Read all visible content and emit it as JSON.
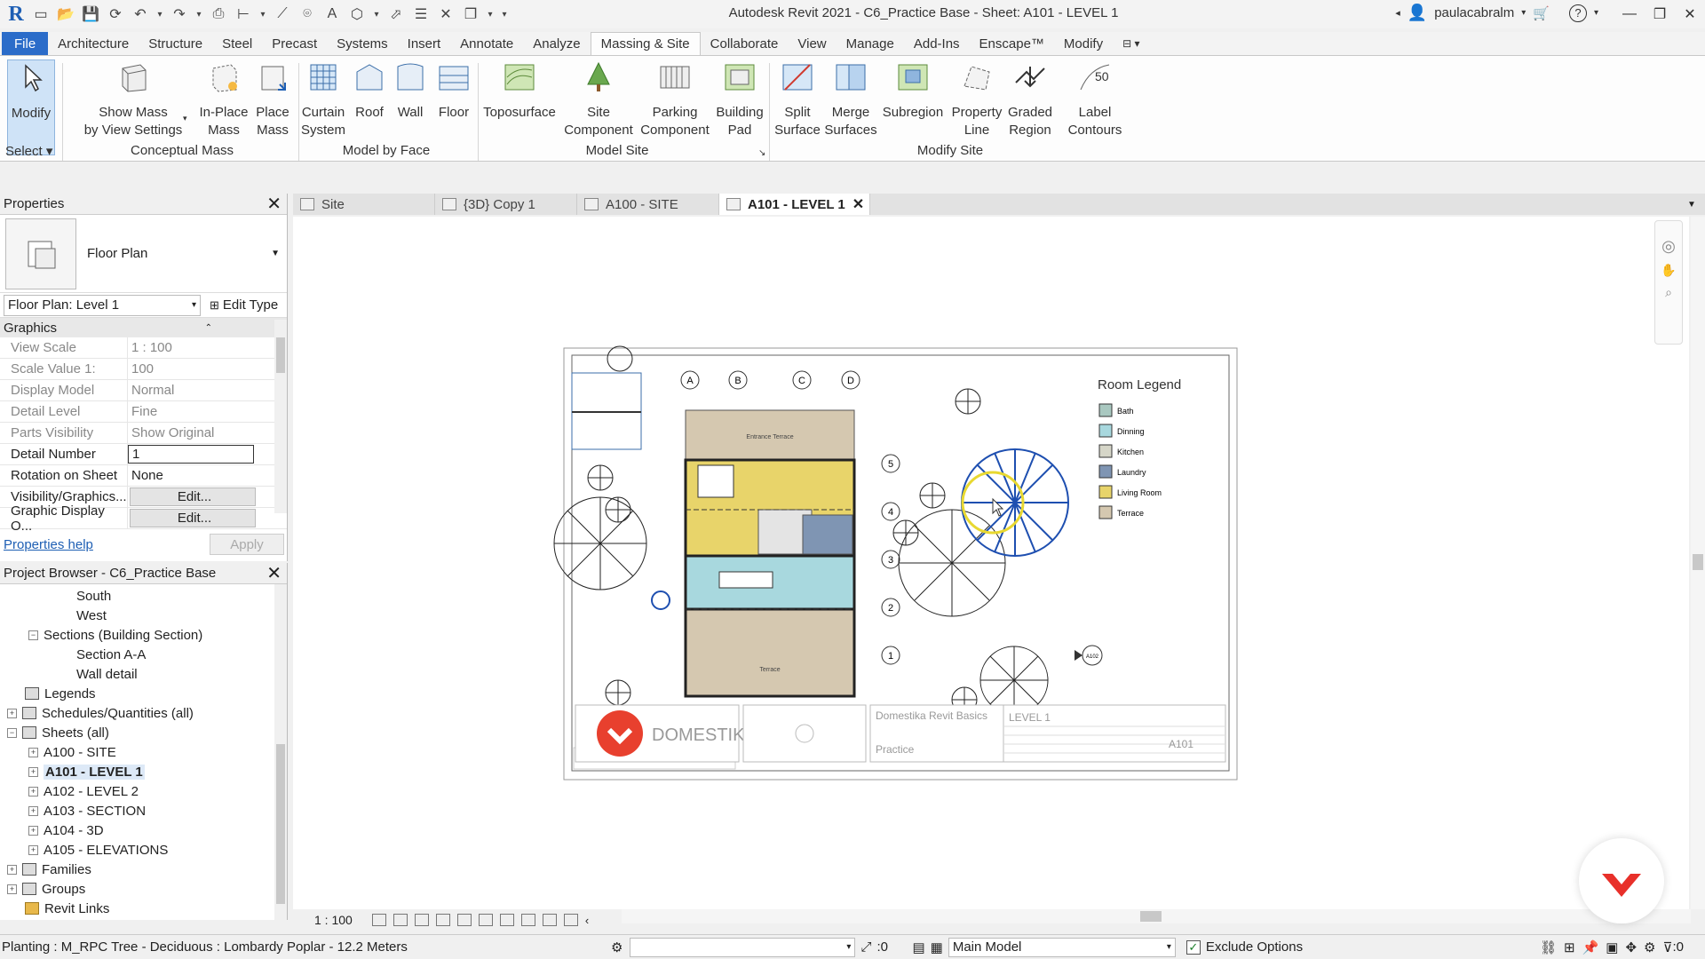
{
  "title_bar": {
    "app_title": "Autodesk Revit 2021 - C6_Practice Base - Sheet: A101 - LEVEL 1",
    "user": "paulacabralm"
  },
  "ribbon_tabs": [
    "File",
    "Architecture",
    "Structure",
    "Steel",
    "Precast",
    "Systems",
    "Insert",
    "Annotate",
    "Analyze",
    "Massing & Site",
    "Collaborate",
    "View",
    "Manage",
    "Add-Ins",
    "Enscape™",
    "Modify"
  ],
  "active_tab": "Massing & Site",
  "ribbon": {
    "modify": "Modify",
    "select": "Select",
    "panels": {
      "conceptual_mass": "Conceptual Mass",
      "model_by_face": "Model by Face",
      "model_site": "Model Site",
      "modify_site": "Modify Site"
    },
    "buttons": {
      "show_mass": [
        "Show Mass",
        "by View Settings"
      ],
      "in_place_mass": [
        "In-Place",
        "Mass"
      ],
      "place_mass": [
        "Place",
        "Mass"
      ],
      "curtain_system": [
        "Curtain",
        "System"
      ],
      "roof": [
        "Roof"
      ],
      "wall": [
        "Wall"
      ],
      "floor": [
        "Floor"
      ],
      "toposurface": [
        "Toposurface"
      ],
      "site_component": [
        "Site",
        "Component"
      ],
      "parking_component": [
        "Parking",
        "Component"
      ],
      "building_pad": [
        "Building",
        "Pad"
      ],
      "split_surface": [
        "Split",
        "Surface"
      ],
      "merge_surfaces": [
        "Merge",
        "Surfaces"
      ],
      "subregion": [
        "Subregion"
      ],
      "property_line": [
        "Property",
        "Line"
      ],
      "graded_region": [
        "Graded",
        "Region"
      ],
      "label_contours": [
        "Label",
        "Contours"
      ]
    }
  },
  "properties": {
    "title": "Properties",
    "type_name": "Floor Plan",
    "instance": "Floor Plan: Level 1",
    "edit_type": "Edit Type",
    "group": "Graphics",
    "rows": [
      {
        "key": "View Scale",
        "value": "1 : 100"
      },
      {
        "key": "Scale Value    1:",
        "value": "100"
      },
      {
        "key": "Display Model",
        "value": "Normal"
      },
      {
        "key": "Detail Level",
        "value": "Fine"
      },
      {
        "key": "Parts Visibility",
        "value": "Show Original"
      },
      {
        "key": "Detail Number",
        "value": "1"
      },
      {
        "key": "Rotation on Sheet",
        "value": "None"
      },
      {
        "key": "Visibility/Graphics...",
        "value": "Edit..."
      },
      {
        "key": "Graphic Display O...",
        "value": "Edit..."
      }
    ],
    "help": "Properties help",
    "apply": "Apply"
  },
  "project_browser": {
    "title": "Project Browser - C6_Practice Base",
    "items": [
      {
        "label": "South"
      },
      {
        "label": "West"
      },
      {
        "label": "Sections (Building Section)"
      },
      {
        "label": "Section A-A"
      },
      {
        "label": "Wall detail"
      },
      {
        "label": "Legends"
      },
      {
        "label": "Schedules/Quantities (all)"
      },
      {
        "label": "Sheets (all)"
      },
      {
        "label": "A100 - SITE"
      },
      {
        "label": "A101 - LEVEL 1"
      },
      {
        "label": "A102 - LEVEL 2"
      },
      {
        "label": "A103 - SECTION"
      },
      {
        "label": "A104 - 3D"
      },
      {
        "label": "A105 - ELEVATIONS"
      },
      {
        "label": "Families"
      },
      {
        "label": "Groups"
      },
      {
        "label": "Revit Links"
      }
    ]
  },
  "view_tabs": [
    "Site",
    "{3D} Copy 1",
    "A100 - SITE",
    "A101 - LEVEL 1"
  ],
  "sheet": {
    "legend_title": "Room Legend",
    "legend": [
      {
        "name": "Bath",
        "color": "#a9c8c0"
      },
      {
        "name": "Dinning",
        "color": "#a8d8de"
      },
      {
        "name": "Kitchen",
        "color": "#d6d6c8"
      },
      {
        "name": "Laundry",
        "color": "#7f95b3"
      },
      {
        "name": "Living Room",
        "color": "#e8d46a"
      },
      {
        "name": "Terrace",
        "color": "#d5c8b0"
      }
    ],
    "grid_letters": [
      "A",
      "B",
      "C",
      "D"
    ],
    "grid_numbers": [
      "5",
      "4",
      "3",
      "2",
      "1"
    ],
    "entrance_label": "Entrance Terrace",
    "terrace_label": "Terrace",
    "elevation_tag": "A102",
    "titleblock": {
      "brand": "DOMESTIKA",
      "project": "Domestika Revit Basics",
      "subtitle": "Practice",
      "level": "LEVEL 1",
      "sheet_no": "A101"
    }
  },
  "view_control": {
    "scale": "1 : 100"
  },
  "status": {
    "text": "Planting : M_RPC Tree - Deciduous : Lombardy Poplar - 12.2 Meters",
    "count": ":0",
    "model": "Main Model",
    "exclude": "Exclude Options",
    "filter_count": ":0"
  }
}
